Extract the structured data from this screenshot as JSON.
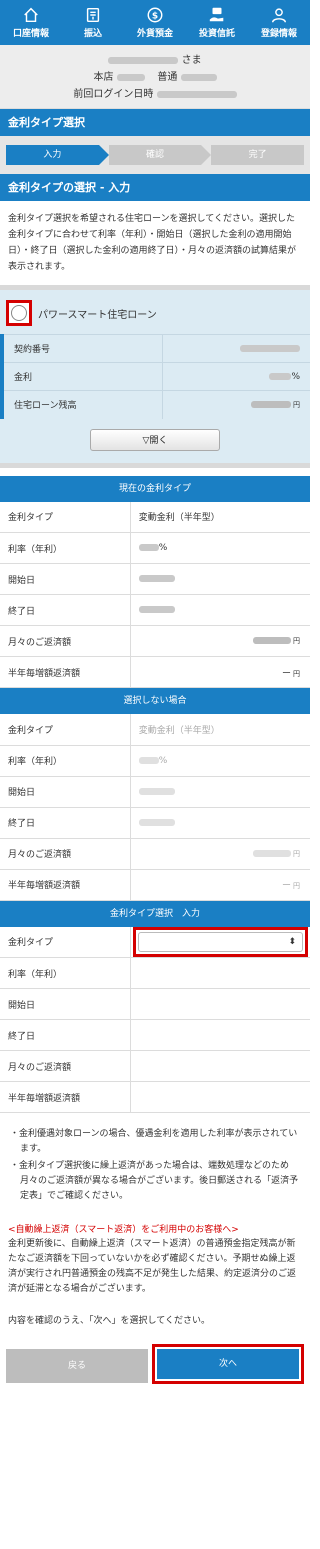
{
  "nav": {
    "items": [
      {
        "label": "口座情報",
        "icon": "home-icon"
      },
      {
        "label": "振込",
        "icon": "transfer-icon"
      },
      {
        "label": "外貨預金",
        "icon": "dollar-coin-icon"
      },
      {
        "label": "投資信託",
        "icon": "investment-icon"
      },
      {
        "label": "登録情報",
        "icon": "user-icon"
      }
    ]
  },
  "user": {
    "name_suffix": "さま",
    "branch": "本店",
    "account_type": "普通",
    "last_login_label": "前回ログイン日時"
  },
  "section_title": "金利タイプ選択",
  "steps": [
    "入力",
    "確認",
    "完了"
  ],
  "sub_title": "金利タイプの選択 - 入力",
  "description": "金利タイプ選択を希望される住宅ローンを選択してください。選択した金利タイプに合わせて利率（年利）・開始日（選択した金利の適用開始日）・終了日（選択した金利の適用終了日）・月々の返済額の試算結果が表示されます。",
  "loan": {
    "name": "パワースマート住宅ローン",
    "contract_label": "契約番号",
    "rate_label": "金利",
    "rate_unit": "%",
    "balance_label": "住宅ローン残高",
    "balance_unit": "円",
    "open_button": "▽開く"
  },
  "current": {
    "title": "現在の金利タイプ",
    "rows": {
      "type_label": "金利タイプ",
      "type_value": "変動金利（半年型）",
      "rate_label": "利率（年利）",
      "rate_unit": "%",
      "start_label": "開始日",
      "end_label": "終了日",
      "monthly_label": "月々のご返済額",
      "monthly_unit": "円",
      "half_label": "半年毎増額返済額",
      "half_value": "ー",
      "half_unit": "円"
    }
  },
  "not_selected": {
    "title": "選択しない場合",
    "rows": {
      "type_label": "金利タイプ",
      "type_value": "変動金利（半年型）",
      "rate_label": "利率（年利）",
      "rate_unit": "%",
      "start_label": "開始日",
      "end_label": "終了日",
      "monthly_label": "月々のご返済額",
      "monthly_unit": "円",
      "half_label": "半年毎増額返済額",
      "half_value": "ー",
      "half_unit": "円"
    }
  },
  "input": {
    "title": "金利タイプ選択　入力",
    "rows": {
      "type_label": "金利タイプ",
      "rate_label": "利率（年利）",
      "start_label": "開始日",
      "end_label": "終了日",
      "monthly_label": "月々のご返済額",
      "half_label": "半年毎増額返済額"
    },
    "select_arrow": "⬍"
  },
  "notes": [
    "・金利優遇対象ローンの場合、優遇金利を適用した利率が表示されています。",
    "・金利タイプ選択後に繰上返済があった場合は、端数処理などのため月々のご返済額が異なる場合がございます。後日郵送される「返済予定表」でご確認ください。"
  ],
  "smart": {
    "title": "<自動繰上返済（スマート返済）をご利用中のお客様へ>",
    "body": "金利更新後に、自動繰上返済（スマート返済）の普通預金指定残高が新たなご返済額を下回っていないかを必ず確認ください。予期せぬ繰上返済が実行され円普通預金の残高不足が発生した結果、約定返済分のご返済が延滞となる場合がございます。"
  },
  "confirm_text": "内容を確認のうえ、「次へ」を選択してください。",
  "buttons": {
    "back": "戻る",
    "next": "次へ"
  }
}
